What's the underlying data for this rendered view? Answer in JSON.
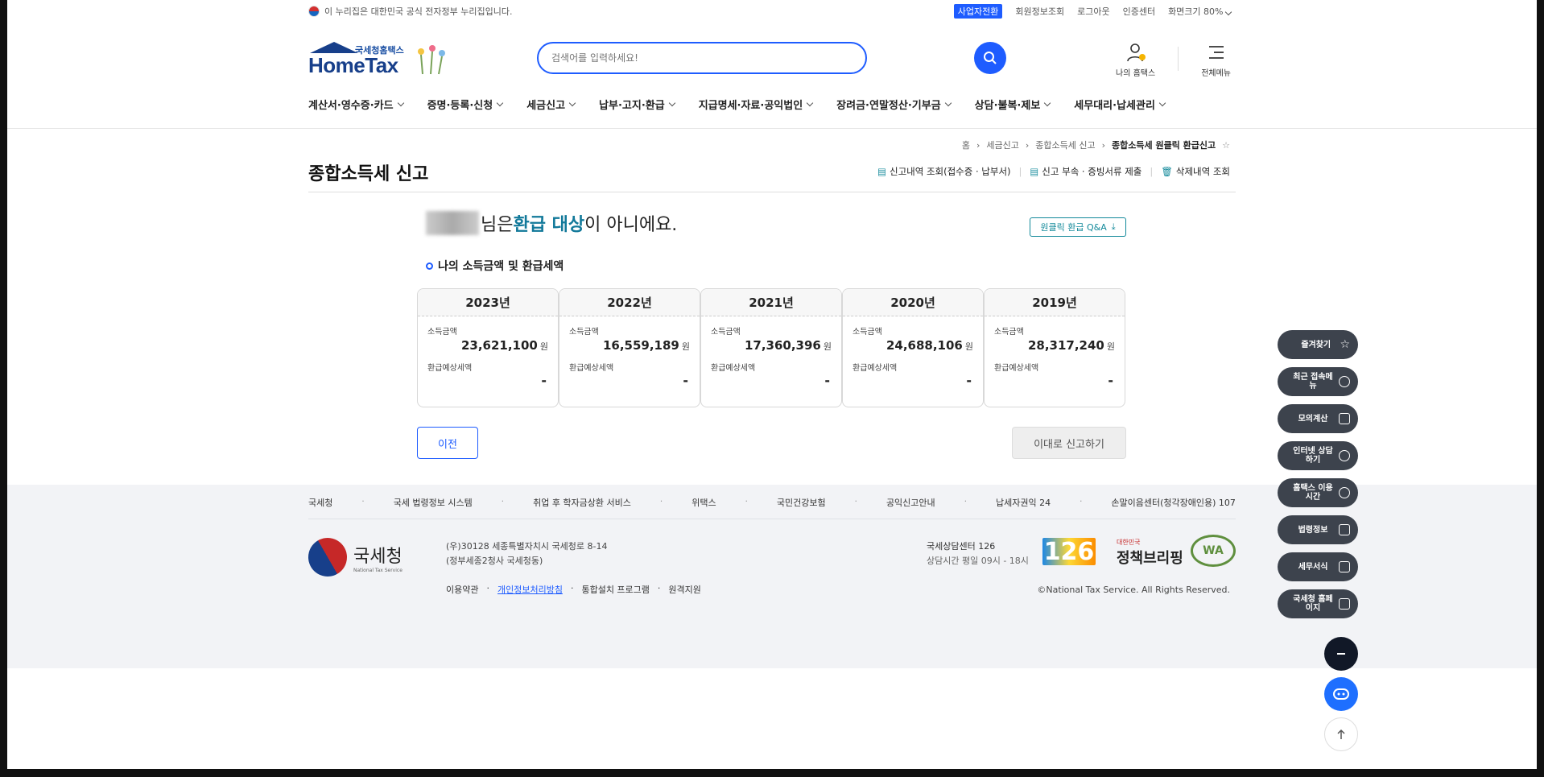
{
  "topbar": {
    "gov_text": "이 누리집은 대한민국 공식 전자정부 누리집입니다.",
    "biz_switch": "사업자전환",
    "member_info": "회원정보조회",
    "logout": "로그아웃",
    "cert_center": "인증센터",
    "zoom_label": "화면크기 80%"
  },
  "logo": {
    "sub": "국세청홈택스",
    "main": "HomeTax"
  },
  "search": {
    "placeholder": "검색어를 입력하세요!"
  },
  "header_right": {
    "my_hometax": "나의 홈택스",
    "all_menu": "전체메뉴"
  },
  "gnb": [
    "계산서·영수증·카드",
    "증명·등록·신청",
    "세금신고",
    "납부·고지·환급",
    "지급명세·자료·공익법인",
    "장려금·연말정산·기부금",
    "상담·불복·제보",
    "세무대리·납세관리"
  ],
  "breadcrumb": {
    "home": "홈",
    "l1": "세금신고",
    "l2": "종합소득세 신고",
    "current": "종합소득세 원클릭 환급신고"
  },
  "page": {
    "title": "종합소득세 신고",
    "link1": "신고내역 조회(접수증 · 납부서)",
    "link2": "신고 부속 · 증빙서류 제출",
    "link3": "삭제내역 조회"
  },
  "hero": {
    "suffix1": "님은 ",
    "highlight": "환급 대상",
    "suffix2": "이 아니에요.",
    "qa_button": "원클릭 환급 Q&A"
  },
  "section_title": "나의 소득금액 및 환급세액",
  "income_label": "소득금액",
  "refund_label": "환급예상세액",
  "unit": "원",
  "years": [
    {
      "year": "2023년",
      "income": "23,621,100",
      "refund": "-"
    },
    {
      "year": "2022년",
      "income": "16,559,189",
      "refund": "-"
    },
    {
      "year": "2021년",
      "income": "17,360,396",
      "refund": "-"
    },
    {
      "year": "2020년",
      "income": "24,688,106",
      "refund": "-"
    },
    {
      "year": "2019년",
      "income": "28,317,240",
      "refund": "-"
    }
  ],
  "buttons": {
    "prev": "이전",
    "submit": "이대로 신고하기"
  },
  "footer": {
    "links": [
      "국세청",
      "국세 법령정보 시스템",
      "취업 후 학자금상환 서비스",
      "위택스",
      "국민건강보험",
      "공익신고안내",
      "납세자권익 24",
      "손말이음센터(청각장애인용) 107"
    ],
    "nts_name": "국세청",
    "nts_en": "National Tax Service",
    "addr1": "(우)30128 세종특별자치시 국세청로 8-14",
    "addr2": "(정부세종2청사 국세청동)",
    "terms": "이용약관",
    "privacy": "개인정보처리방침",
    "install": "통합설치 프로그램",
    "remote": "원격지원",
    "center": "국세상담센터 126",
    "hours": "상담시간 평일 09시 - 18시",
    "b126": "126",
    "policy_small": "대한민국",
    "policy": "정책브리핑",
    "wa": "WA",
    "copyright": "©National Tax Service. All Rights Reserved."
  },
  "quick": [
    "즐겨찾기",
    "최근 접속메뉴",
    "모의계산",
    "인터넷 상담하기",
    "홈택스 이용시간",
    "법령정보",
    "세무서식",
    "국세청 홈페이지"
  ]
}
